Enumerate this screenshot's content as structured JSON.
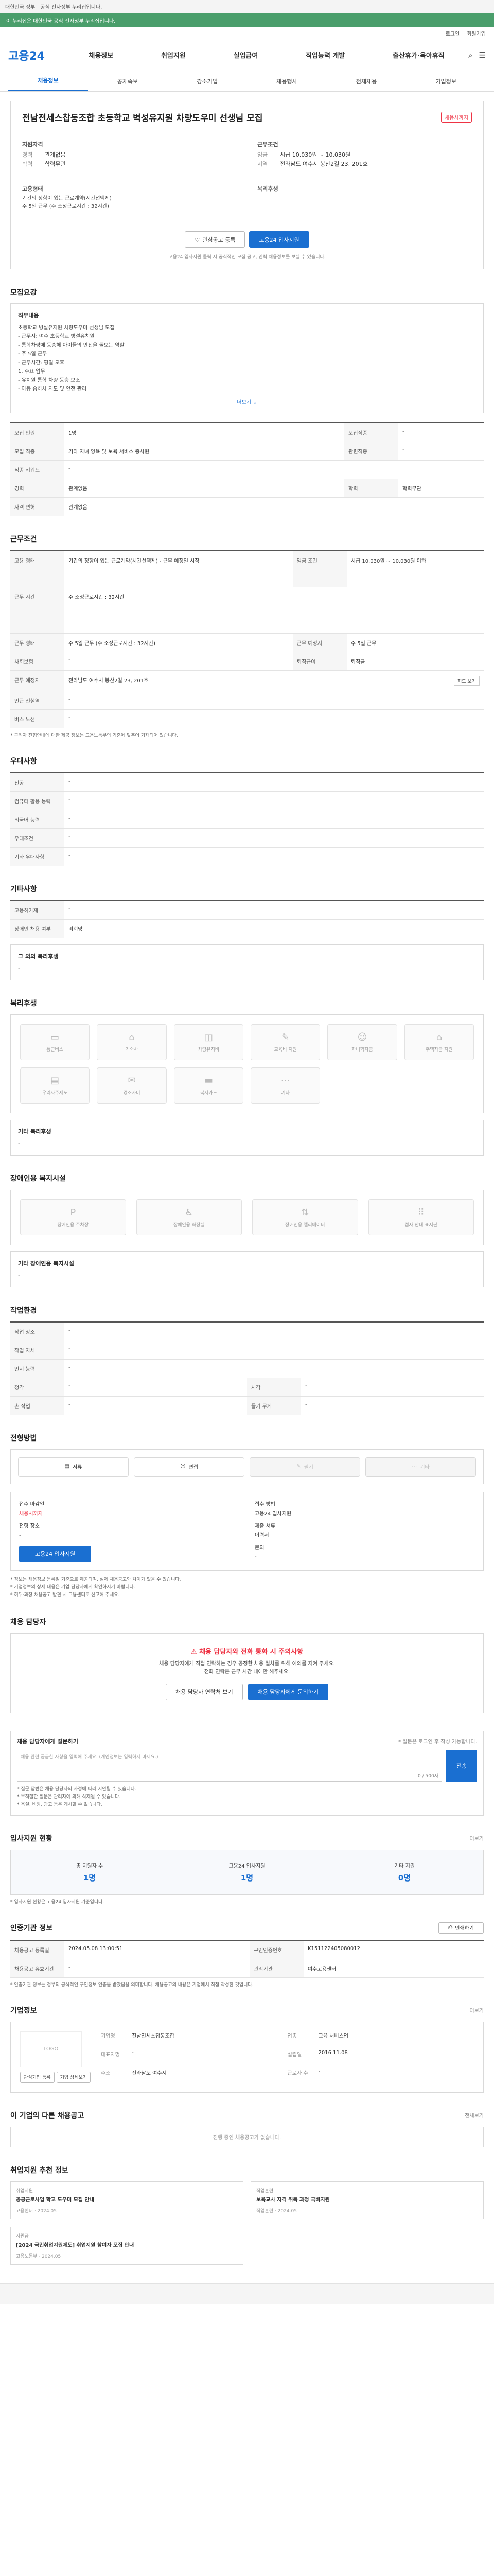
{
  "topbar": {
    "links": [
      "대한민국 정부",
      "공식 전자정부 누리집입니다."
    ]
  },
  "govbar": {
    "text": "이 누리집은 대한민국 공식 전자정부 누리집입니다."
  },
  "usermenu": {
    "login": "로그인",
    "join": "회원가입"
  },
  "header": {
    "logo": "고용24",
    "gnb": [
      "채용정보",
      "취업지원",
      "실업급여",
      "직업능력 개발",
      "출산휴가·육아휴직"
    ]
  },
  "subnav": [
    "채용정보",
    "공채속보",
    "강소기업",
    "채용행사",
    "전체채용",
    "기업정보"
  ],
  "job": {
    "title": "전남전세스찹동조합 초등학교 벽성유지원 차량도우미 선생님 모집",
    "badge": "채용시까지",
    "company_sec": "지원자격",
    "company_rows": [
      {
        "k": "경력",
        "v": "관계없음"
      },
      {
        "k": "학력",
        "v": "학력무관"
      }
    ],
    "work_sec": "근무조건",
    "work_rows": [
      {
        "k": "임금",
        "v": "시급 10,030원 ~ 10,030원"
      },
      {
        "k": "지역",
        "v": "전라남도 여수시 봉산2길 23, 201호"
      }
    ],
    "form_sec": "고용형태",
    "form_lines": [
      "기간의 정함이 있는 근로계약(시간선택제)",
      "주 5일 근무 (주 소정근로시간 : 32시간)"
    ],
    "welfare_sec": "복리후생",
    "btn_scrap": "관심공고 등록",
    "btn_apply": "고용24 입사지원",
    "apply_note": "고용24 입사지원 클릭 시 공식적인 모집 공고, 인력 채용정보를 보실 수 있습니다."
  },
  "detail": {
    "title": "모집요강",
    "sub": "직무내용",
    "body": "초등학교 병설유지원 차량도우미 선생님 모집\n- 근무지: 여수 초등학교 병설유치원\n- 통학차량에 동승해 아이들의 안전을 돌보는 역할\n- 주 5일 근무\n- 근무시간: 평일 오후\n1. 주요 업무\n- 유치원 통학 차량 동승 보조\n- 아동 승하차 지도 및 안전 관리",
    "more": "더보기"
  },
  "req_table": {
    "rows": [
      {
        "k": "모집 인원",
        "v": "1명",
        "k2": "모집직종",
        "v2": "-"
      },
      {
        "k": "모집 직종",
        "v": "기타 자녀 양육 및 보육 서비스 종사원",
        "k2": "관련직종",
        "v2": "-"
      },
      {
        "k": "직종 키워드",
        "v": "-",
        "k2": "",
        "v2": ""
      },
      {
        "k": "경력",
        "v": "관계없음",
        "k2": "학력",
        "v2": "학력무관"
      },
      {
        "k": "자격 면허",
        "v": "관계없음",
        "k2": "",
        "v2": ""
      }
    ]
  },
  "work": {
    "title": "근무조건",
    "rows": [
      {
        "k": "고용 형태",
        "v": "기간의 정함이 있는 근로계약(시간선택제) - 근무 예정일 시작",
        "k2": "임금 조건",
        "v2": "시급 10,030원 ~ 10,030원 이하"
      },
      {
        "k": "근무 시간",
        "v": "주 소정근로시간 : 32시간",
        "k2": "",
        "v2": ""
      },
      {
        "k": "근무 형태",
        "v": "주 5일 근무 (주 소정근로시간 : 32시간)",
        "k2": "근무 예정지",
        "v2": "주 5일 근무"
      },
      {
        "k": "사회보험",
        "v": "-",
        "k2": "퇴직급여",
        "v2": "퇴직금"
      },
      {
        "k": "근무 예정지",
        "v": "전라남도 여수시 봉산2길 23, 201호",
        "k2": "",
        "v2": ""
      },
      {
        "k": "인근 전철역",
        "v": "-",
        "k2": "",
        "v2": ""
      },
      {
        "k": "버스 노선",
        "v": "-",
        "k2": "",
        "v2": ""
      }
    ],
    "map_btn": "지도 보기",
    "note": "* 구직자 전형안내에 대한 제공 정보는 고용노동부의 기준에 맞추어 기재되어 있습니다."
  },
  "prefer": {
    "title": "우대사항",
    "rows": [
      {
        "k": "전공",
        "v": "-"
      },
      {
        "k": "컴퓨터 활용 능력",
        "v": "-"
      },
      {
        "k": "외국어 능력",
        "v": "-"
      },
      {
        "k": "우대조건",
        "v": "-"
      },
      {
        "k": "기타 우대사항",
        "v": "-"
      }
    ]
  },
  "etc": {
    "title": "기타사항",
    "rows": [
      {
        "k": "고용허가제",
        "v": "-"
      },
      {
        "k": "장애인 채용 여부",
        "v": "비희망"
      }
    ],
    "sub": "그 외의 복리후생",
    "sub_v": "-"
  },
  "welfare": {
    "title": "복리후생",
    "items": [
      {
        "label": "통근버스",
        "icon": "bus-icon"
      },
      {
        "label": "기숙사",
        "icon": "dorm-icon"
      },
      {
        "label": "차량유지비",
        "icon": "car-icon"
      },
      {
        "label": "교육비 지원",
        "icon": "edu-icon"
      },
      {
        "label": "자녀학자금",
        "icon": "child-icon"
      },
      {
        "label": "주택자금 지원",
        "icon": "house-icon"
      },
      {
        "label": "우리사주제도",
        "icon": "stock-icon"
      },
      {
        "label": "경조사비",
        "icon": "gift-icon"
      },
      {
        "label": "복지카드",
        "icon": "card-icon"
      },
      {
        "label": "기타",
        "icon": "etc-icon"
      }
    ],
    "etc_label": "기타 복리후생",
    "etc_v": "-"
  },
  "disab": {
    "title": "장애인용 복지시설",
    "items": [
      {
        "label": "장애인용 주차장",
        "icon": "parking-icon"
      },
      {
        "label": "장애인용 화장실",
        "icon": "toilet-icon"
      },
      {
        "label": "장애인용 엘리베이터",
        "icon": "elevator-icon"
      },
      {
        "label": "점자 안내 표지판",
        "icon": "braille-icon"
      }
    ],
    "etc_label": "기타 장애인용 복지시설",
    "etc_v": "-"
  },
  "env": {
    "title": "작업환경",
    "rows": [
      {
        "k": "작업 장소",
        "v": "-",
        "k2": "",
        "v2": ""
      },
      {
        "k": "작업 자세",
        "v": "-",
        "k2": "",
        "v2": ""
      },
      {
        "k": "인지 능력",
        "v": "-",
        "k2": "",
        "v2": ""
      },
      {
        "k": "청각",
        "v": "-",
        "k2": "시각",
        "v2": "-"
      },
      {
        "k": "손 작업",
        "v": "-",
        "k2": "들기 무게",
        "v2": "-"
      }
    ]
  },
  "process": {
    "title": "전형방법",
    "steps": [
      {
        "label": "서류",
        "on": true,
        "icon": "doc-icon"
      },
      {
        "label": "면접",
        "on": true,
        "icon": "interview-icon"
      },
      {
        "label": "필기",
        "on": false,
        "icon": "pen-icon"
      },
      {
        "label": "기타",
        "on": false,
        "icon": "more-icon"
      }
    ],
    "m_left": [
      {
        "k": "접수 마감일",
        "v": "채용시까지"
      },
      {
        "k": "전형 장소",
        "v": "-"
      }
    ],
    "m_right": [
      {
        "k": "접수 방법",
        "v": "고용24 입사지원"
      },
      {
        "k": "제출 서류",
        "v": "이력서"
      },
      {
        "k": "문의",
        "v": "-"
      }
    ],
    "apply_btn": "고용24 입사지원",
    "help": "* 정보는 채용정보 등록일 기준으로 제공되며, 실제 채용공고와 차이가 있을 수 있습니다.\n* 기업정보의 상세 내용은 기업 담당자에게 확인하시기 바랍니다.\n* 허위·과장 채용공고 발견 시 고용센터로 신고해 주세요."
  },
  "contact": {
    "title": "채용 담당자",
    "alert": "채용 담당자와 전화 통화 시 주의사항",
    "desc": "채용 담당자에게 직접 연락하는 경우 공정한 채용 절차를 위해 예의를 지켜 주세요.\n전화 연락은 근무 시간 내에만 해주세요.",
    "btn1": "채용 담당자 연락처 보기",
    "btn2": "채용 담당자에게 문의하기"
  },
  "qa": {
    "title": "채용 담당자에게 질문하기",
    "note_right": "* 질문은 로그인 후 작성 가능합니다.",
    "placeholder": "채용 관련 궁금한 사항을 입력해 주세요. (개인정보는 입력하지 마세요.)",
    "count": "0 / 500자",
    "btn": "전송",
    "notes": "* 질문 답변은 채용 담당자의 사정에 따라 지연될 수 있습니다.\n* 부적절한 질문은 관리자에 의해 삭제될 수 있습니다.\n* 욕설, 비방, 광고 등은 게시할 수 없습니다."
  },
  "status": {
    "title": "입사지원 현황",
    "more": "더보기",
    "stats": [
      {
        "label": "총 지원자 수",
        "num": "1명"
      },
      {
        "label": "고용24 입사지원",
        "num": "1명"
      },
      {
        "label": "기타 지원",
        "num": "0명"
      }
    ],
    "note": "* 입사지원 현황은 고용24 입사지원 기준입니다."
  },
  "info": {
    "title": "인증기관 정보",
    "btn": "인쇄하기",
    "rows": [
      {
        "k": "채용공고 등록일",
        "v": "2024.05.08 13:00:51",
        "k2": "구인인증번호",
        "v2": "K151122405080012"
      },
      {
        "k": "채용공고 유효기간",
        "v": "-",
        "k2": "관리기관",
        "v2": "여수고용센터"
      }
    ],
    "note": "* 인증기관 정보는 정부의 공식적인 구인정보 인증을 받았음을 의미합니다. 채용공고의 내용은 기업에서 직접 작성한 것입니다."
  },
  "company": {
    "title": "기업정보",
    "more": "더보기",
    "logo": "LOGO",
    "rows": [
      {
        "k": "기업명",
        "v": "전남전세스찹동조합",
        "k2": "업종",
        "v2": "교육 서비스업"
      },
      {
        "k": "대표자명",
        "v": "-",
        "k2": "설립일",
        "v2": "2016.11.08"
      },
      {
        "k": "주소",
        "v": "전라남도 여수시",
        "k2": "근로자 수",
        "v2": "-"
      }
    ],
    "btn1": "관심기업 등록",
    "btn2": "기업 상세보기"
  },
  "others": {
    "title": "이 기업의 다른 채용공고",
    "more": "전체보기",
    "empty": "진행 중인 채용공고가 없습니다."
  },
  "news": {
    "title": "취업지원 추천 정보",
    "items": [
      {
        "tag": "취업지원",
        "title": "공공근로사업 학교 도우미 모집 안내",
        "meta": "고용센터 · 2024.05"
      },
      {
        "tag": "직업훈련",
        "title": "보육교사 자격 취득 과정 국비지원",
        "meta": "직업훈련 · 2024.05"
      },
      {
        "tag": "지원금",
        "title": "[2024 국민취업지원제도] 취업지원 참여자 모집 안내",
        "meta": "고용노동부 · 2024.05"
      }
    ]
  }
}
